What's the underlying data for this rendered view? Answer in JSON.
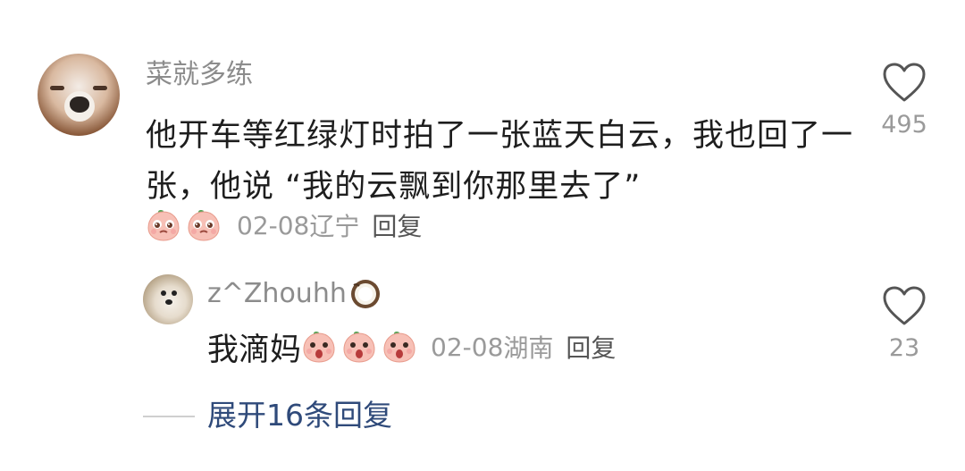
{
  "main_comment": {
    "username": "菜就多练",
    "text": "他开车等红绿灯时拍了一张蓝天白云，我也回了一张，他说 “我的云飘到你那里去了”",
    "date": "02-08",
    "location": "辽宁",
    "reply_label": "回复",
    "like_count": "495",
    "emoji": "peach-face-emoji"
  },
  "reply_comment": {
    "username": "z^Zhouhh",
    "text": "我滴妈",
    "date": "02-08",
    "location": "湖南",
    "reply_label": "回复",
    "like_count": "23",
    "emoji": "peach-face-emoji"
  },
  "expand_label": "展开16条回复",
  "icons": {
    "like": "heart-outline-icon",
    "coconut": "coconut-emoji"
  },
  "colors": {
    "text_main": "#1e1e1e",
    "text_meta": "#9a9a9a",
    "link": "#2f4a7a"
  }
}
